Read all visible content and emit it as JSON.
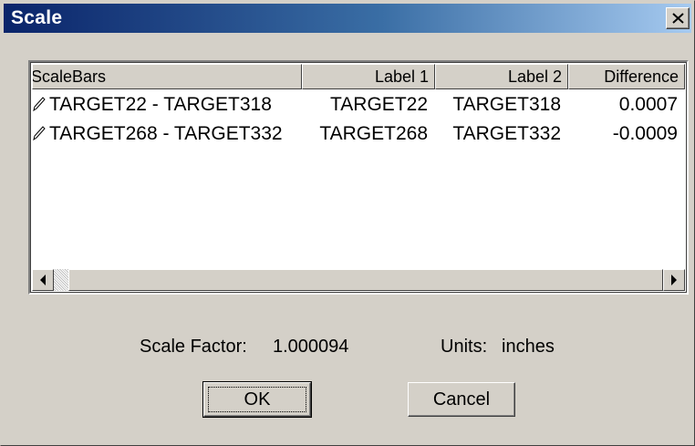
{
  "window": {
    "title": "Scale"
  },
  "table": {
    "columns": [
      "ScaleBars",
      "Label 1",
      "Label 2",
      "Difference"
    ],
    "rows": [
      {
        "scalebar": "TARGET22 - TARGET318",
        "label1": "TARGET22",
        "label2": "TARGET318",
        "difference": "0.0007"
      },
      {
        "scalebar": "TARGET268 - TARGET332",
        "label1": "TARGET268",
        "label2": "TARGET332",
        "difference": "-0.0009"
      }
    ]
  },
  "info": {
    "scale_factor_label": "Scale Factor:",
    "scale_factor_value": "1.000094",
    "units_label": "Units:",
    "units_value": "inches"
  },
  "buttons": {
    "ok": "OK",
    "cancel": "Cancel"
  },
  "icons": {
    "close": "close-icon",
    "row": "pencil-icon",
    "scroll_left": "arrow-left-icon",
    "scroll_right": "arrow-right-icon"
  }
}
